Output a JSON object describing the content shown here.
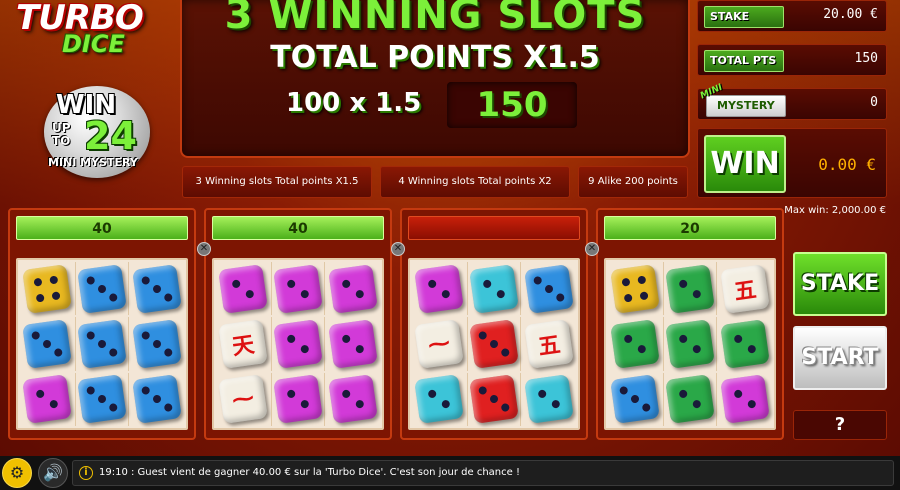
{
  "logo": {
    "line1": "TURBO",
    "line2": "DICE"
  },
  "badge": {
    "win": "WIN",
    "upto": "UP TO",
    "amount": "24",
    "label": "MINI MYSTERY"
  },
  "main_panel": {
    "title": "3 WINNING SLOTS",
    "subtitle": "TOTAL POINTS X1.5",
    "calculation": "100 x 1.5",
    "result": "150"
  },
  "rules": [
    {
      "label": "3 Winning slots Total points X1.5"
    },
    {
      "label": "4 Winning slots Total points X2"
    },
    {
      "label": "9 Alike 200 points"
    }
  ],
  "right_panel": {
    "stake_label": "STAKE",
    "stake_value": "20.00 €",
    "total_pts_label": "TOTAL PTS",
    "total_pts_value": "150",
    "mini_label": "MINI",
    "mystery_label": "MYSTERY",
    "mystery_value": "0",
    "win_label": "WIN",
    "win_value": "0.00 €",
    "max_win": "Max win: 2,000.00 €"
  },
  "reels": [
    {
      "points": "40",
      "header_state": "green",
      "dice": [
        {
          "color": "#e8b820",
          "face": "pips",
          "n": 4
        },
        {
          "color": "#2f8fe0",
          "face": "pips",
          "n": 3
        },
        {
          "color": "#2f8fe0",
          "face": "pips",
          "n": 3
        },
        {
          "color": "#2f8fe0",
          "face": "pips",
          "n": 3
        },
        {
          "color": "#2f8fe0",
          "face": "pips",
          "n": 3
        },
        {
          "color": "#2f8fe0",
          "face": "pips",
          "n": 3
        },
        {
          "color": "#d23ad8",
          "face": "pips",
          "n": 2
        },
        {
          "color": "#2f8fe0",
          "face": "pips",
          "n": 3
        },
        {
          "color": "#2f8fe0",
          "face": "pips",
          "n": 3
        }
      ]
    },
    {
      "points": "40",
      "header_state": "green",
      "dice": [
        {
          "color": "#d23ad8",
          "face": "pips",
          "n": 2
        },
        {
          "color": "#d23ad8",
          "face": "pips",
          "n": 2
        },
        {
          "color": "#d23ad8",
          "face": "pips",
          "n": 2
        },
        {
          "color": "#f3eee2",
          "face": "symbol",
          "symbol": "天"
        },
        {
          "color": "#d23ad8",
          "face": "pips",
          "n": 2
        },
        {
          "color": "#d23ad8",
          "face": "pips",
          "n": 2
        },
        {
          "color": "#f3eee2",
          "face": "symbol",
          "symbol": "⁓"
        },
        {
          "color": "#d23ad8",
          "face": "pips",
          "n": 2
        },
        {
          "color": "#d23ad8",
          "face": "pips",
          "n": 2
        }
      ]
    },
    {
      "points": "",
      "header_state": "red",
      "dice": [
        {
          "color": "#d23ad8",
          "face": "pips",
          "n": 2
        },
        {
          "color": "#3cc4d8",
          "face": "pips",
          "n": 2
        },
        {
          "color": "#2f8fe0",
          "face": "pips",
          "n": 3
        },
        {
          "color": "#f3eee2",
          "face": "symbol",
          "symbol": "⁓"
        },
        {
          "color": "#e02020",
          "face": "pips",
          "n": 3
        },
        {
          "color": "#f3eee2",
          "face": "symbol",
          "symbol": "五"
        },
        {
          "color": "#3cc4d8",
          "face": "pips",
          "n": 2
        },
        {
          "color": "#e02020",
          "face": "pips",
          "n": 3
        },
        {
          "color": "#3cc4d8",
          "face": "pips",
          "n": 2
        }
      ]
    },
    {
      "points": "20",
      "header_state": "green",
      "dice": [
        {
          "color": "#e8b820",
          "face": "pips",
          "n": 4
        },
        {
          "color": "#2aa848",
          "face": "pips",
          "n": 2
        },
        {
          "color": "#f3eee2",
          "face": "symbol",
          "symbol": "五"
        },
        {
          "color": "#2aa848",
          "face": "pips",
          "n": 2
        },
        {
          "color": "#2aa848",
          "face": "pips",
          "n": 2
        },
        {
          "color": "#2aa848",
          "face": "pips",
          "n": 2
        },
        {
          "color": "#2f8fe0",
          "face": "pips",
          "n": 3
        },
        {
          "color": "#2aa848",
          "face": "pips",
          "n": 2
        },
        {
          "color": "#d23ad8",
          "face": "pips",
          "n": 2
        }
      ]
    }
  ],
  "buttons": {
    "stake": "STAKE",
    "start": "START",
    "help": "?"
  },
  "ticker": {
    "info": "i",
    "message": "19:10 : Guest vient de gagner 40.00 € sur la 'Turbo Dice'. C'est son jour de chance !"
  },
  "colors": {
    "accent_green": "#7cf03a",
    "background_red": "#8a1c04",
    "win_value": "#ffb000"
  }
}
